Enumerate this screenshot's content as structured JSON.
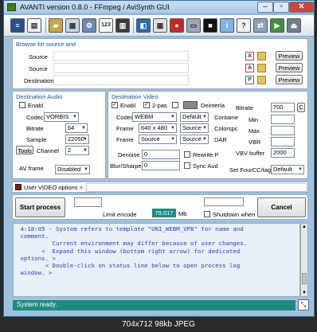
{
  "window": {
    "title": "AVANTI  version  0.8.0  -  FFmpeg / AviSynth GUI"
  },
  "toolbar": {
    "icons": [
      "toolbar-icon-1",
      "toolbar-icon-2",
      "toolbar-icon-3",
      "toolbar-icon-4",
      "toolbar-icon-5",
      "toolbar-icon-6",
      "toolbar-icon-7",
      "toolbar-icon-8",
      "toolbar-icon-9",
      "toolbar-icon-10",
      "toolbar-icon-11",
      "toolbar-icon-12",
      "toolbar-icon-13",
      "toolbar-icon-14",
      "toolbar-icon-15"
    ],
    "calendar_text": "123"
  },
  "browse": {
    "title": "Browse for source and",
    "source1_label": "Source",
    "source2_label": "Source",
    "destination_label": "Destination",
    "preview_label": "Preview",
    "letter_a": "A",
    "letter_p": "P"
  },
  "audio": {
    "title": "Destination Audio",
    "enable_label": "Enabl",
    "codec_label": "Codec",
    "codec_value": "VORBIS",
    "bitrate_label": "Bitrate",
    "bitrate_value": "64",
    "sample_label": "Sample",
    "sample_value": "22050",
    "tools_label": "Tools",
    "channel_label": "Channel",
    "channel_value": "2",
    "avframe_label": "AV frame",
    "avframe_value": "Disabled"
  },
  "video": {
    "title": "Destination Video",
    "enable_label": "Enabl",
    "twopass_label": "2-pas",
    "deinterlace_label": "Deinterla",
    "codec_label": "Codec",
    "codec_value": "WEBM",
    "codec_preset": "Default",
    "frame_label": "Frame",
    "frame_value": "640 x 480",
    "frame_preset": "Source",
    "frame2_label": "Frame",
    "frame2_value": "Source",
    "frame2_preset": "Source",
    "denoise_label": "Denoise",
    "denoise_value": "0",
    "blur_label": "Blur/Sharpen",
    "blur_value": "0",
    "rewrite_label": "Rewrite P",
    "syncaud_label": "Sync Aud",
    "bitrate_label": "Bitrate",
    "bitrate_value": "700",
    "bitrate_unit": "C",
    "container_label": "Containe",
    "min_label": "Min",
    "colorspace_label": "Colorspc",
    "max_label": "Max",
    "dar_label": "DAR",
    "vbr_label": "VBR",
    "vbv_label": "VBV buffer",
    "vbv_value": "2000",
    "fourcc_label": "Set FourCC/tag",
    "fourcc_value": "Default"
  },
  "options": {
    "user_video_label": "User VIDEO options >"
  },
  "actions": {
    "start_label": "Start process",
    "limit_label": "Limit encode",
    "size_value": "79.017",
    "size_unit": "Mb",
    "shutdown_label": "Shutdown when",
    "cancel_label": "Cancel"
  },
  "log": {
    "lines": [
      " 4:18:05 - System refers to template \"UNI_WEBM_VP8\" for name and",
      " comment.",
      "          Current environment may differ because of user changes.",
      "",
      "       <  Expand this window (bottom right arrow) for dedicated",
      " options. >",
      "        < Double-click on status line below to open process log",
      " window. >"
    ]
  },
  "status": {
    "text": "System ready."
  },
  "caption": {
    "text": "704x712  98kb  JPEG"
  }
}
